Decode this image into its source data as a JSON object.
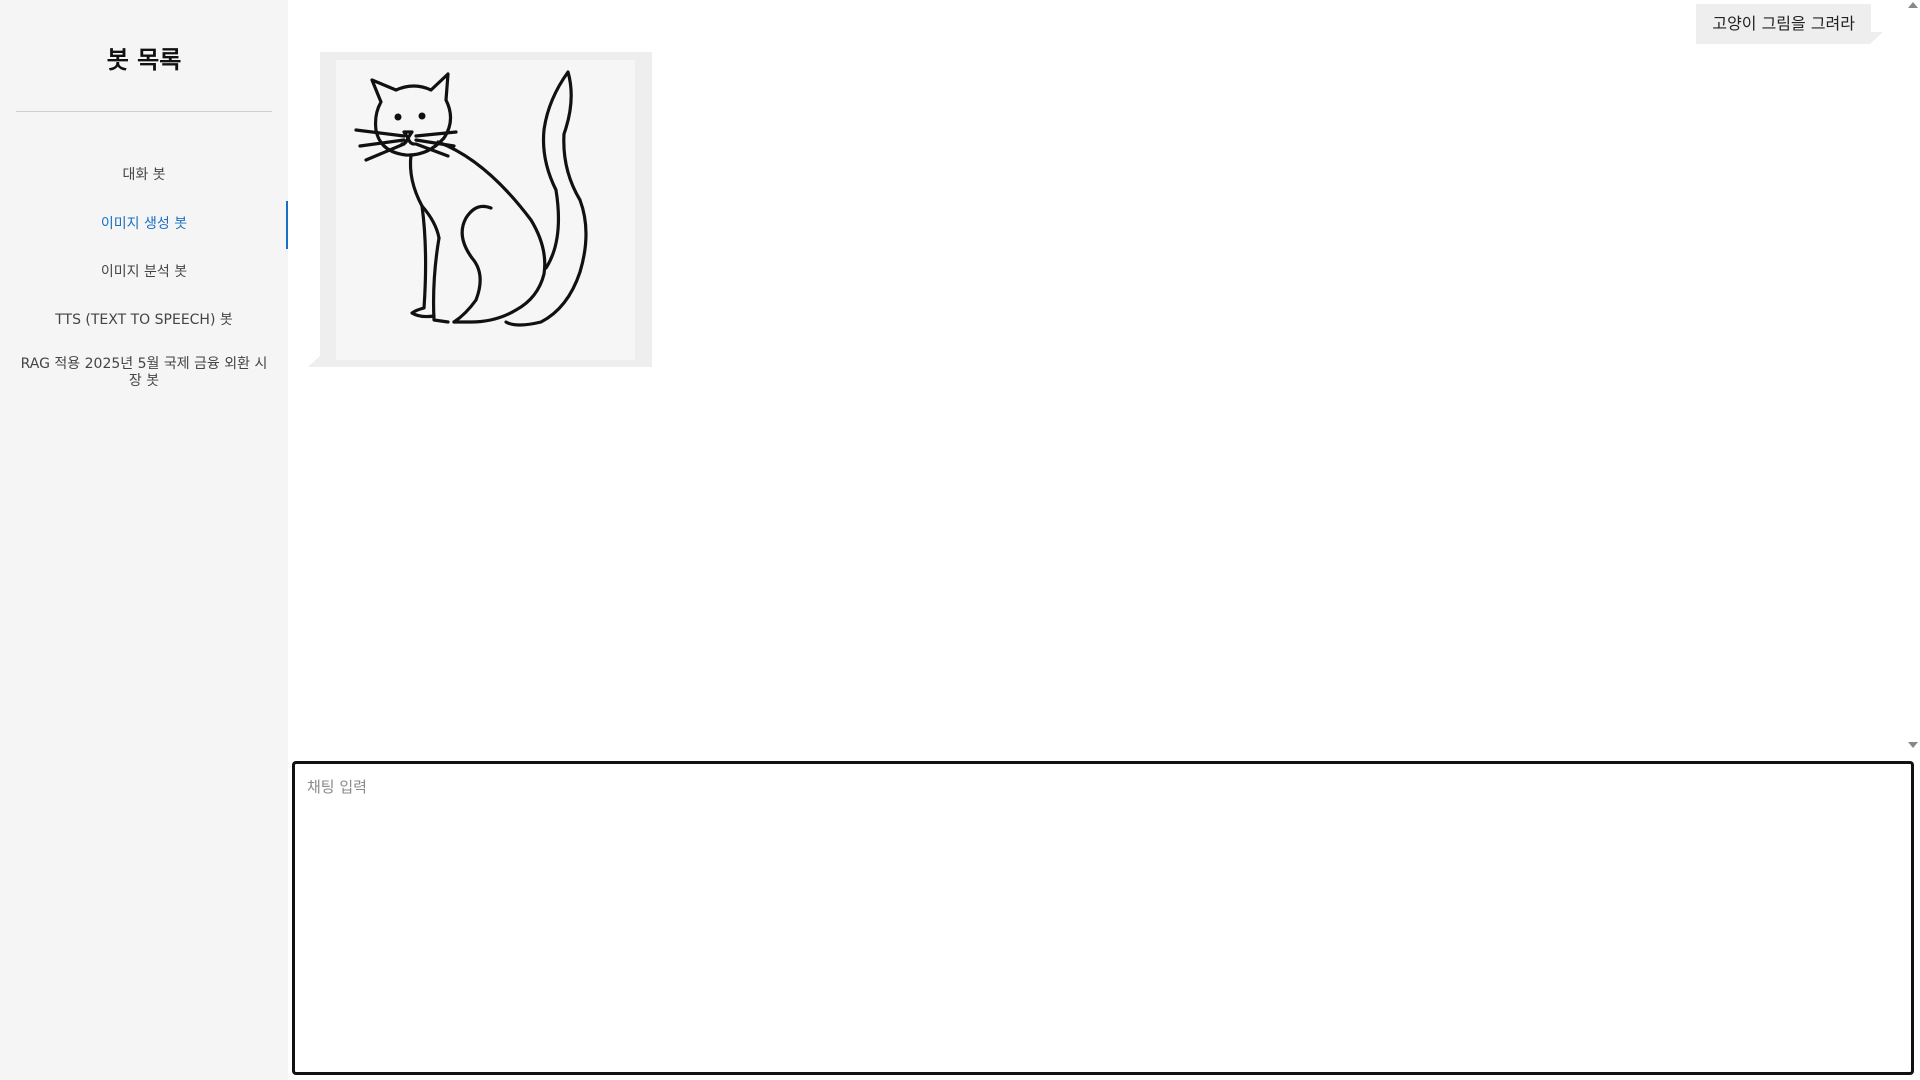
{
  "sidebar": {
    "title": "봇 목록",
    "items": [
      {
        "label": "대화 봇",
        "active": false
      },
      {
        "label": "이미지 생성 봇",
        "active": true
      },
      {
        "label": "이미지 분석 봇",
        "active": false
      },
      {
        "label": "TTS (TEXT TO SPEECH) 봇",
        "active": false
      },
      {
        "label": "RAG 적용 2025년 5월 국제 금융 외환 시장 봇",
        "active": false
      }
    ]
  },
  "chat": {
    "messages": [
      {
        "role": "user",
        "text": "고양이 그림을 그려라"
      },
      {
        "role": "bot",
        "type": "image",
        "image_subject": "cat line drawing"
      }
    ]
  },
  "input": {
    "placeholder": "채팅 입력",
    "value": ""
  },
  "colors": {
    "accent": "#1a6fc4",
    "sidebar_bg": "#f5f5f5",
    "bubble_bg": "#eeeeee",
    "input_border": "#111111"
  }
}
